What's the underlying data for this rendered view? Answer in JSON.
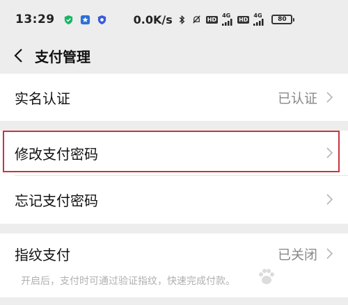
{
  "status_bar": {
    "time": "13:29",
    "net_speed": "0.0K/s",
    "hd1": "HD",
    "g4_1": "4G",
    "hd2": "HD",
    "g4_2": "4G",
    "battery": "80"
  },
  "nav": {
    "title": "支付管理"
  },
  "rows": {
    "realname": {
      "label": "实名认证",
      "value": "已认证"
    },
    "modify": {
      "label": "修改支付密码"
    },
    "forgot": {
      "label": "忘记支付密码"
    }
  },
  "fingerprint": {
    "label": "指纹支付",
    "value": "已关闭",
    "description": "开启后，支付时可通过验证指纹，快速完成付款。"
  },
  "colors": {
    "highlight": "#c8333e",
    "background": "#ededed"
  }
}
